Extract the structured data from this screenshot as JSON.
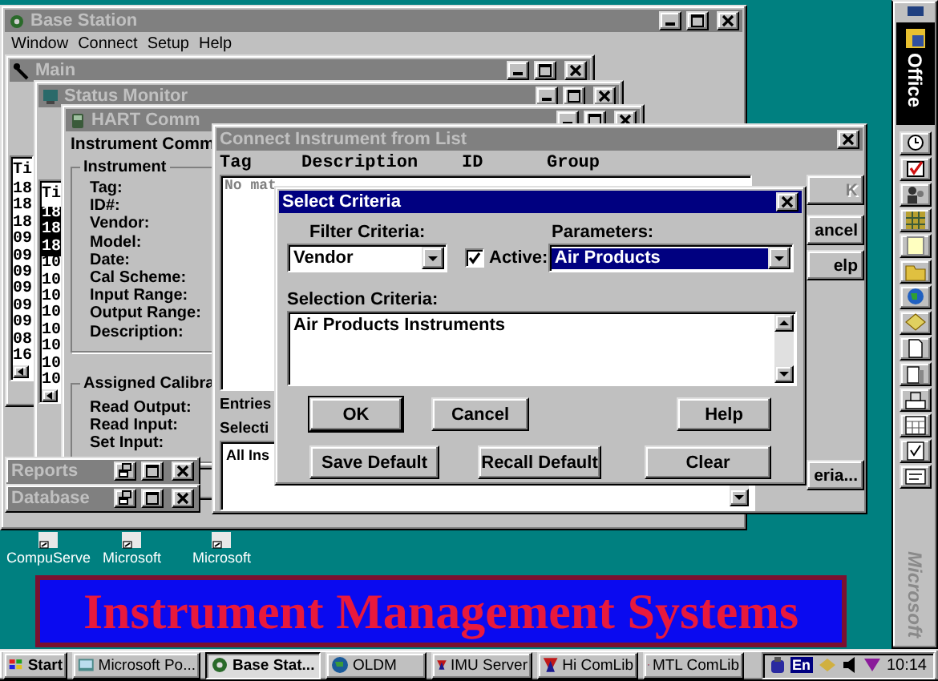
{
  "base_station": {
    "title": "Base Station",
    "active": false,
    "menu": [
      "Window",
      "Connect",
      "Setup",
      "Help"
    ]
  },
  "main_window": {
    "title": "Main",
    "active": false,
    "list_header": "Ti",
    "rows": [
      {
        "text": "18",
        "selected": false
      },
      {
        "text": "18",
        "selected": false
      },
      {
        "text": "18",
        "selected": false
      },
      {
        "text": "09",
        "selected": false
      },
      {
        "text": "09",
        "selected": false
      },
      {
        "text": "09",
        "selected": false
      },
      {
        "text": "09",
        "selected": false
      },
      {
        "text": "09",
        "selected": false
      },
      {
        "text": "09",
        "selected": false
      },
      {
        "text": "08",
        "selected": false
      },
      {
        "text": "16",
        "selected": false
      }
    ]
  },
  "status_monitor": {
    "title": "Status Monitor",
    "active": false,
    "list_header": "Ti",
    "rows": [
      {
        "text": "18",
        "selected": true
      },
      {
        "text": "18",
        "selected": true
      },
      {
        "text": "18",
        "selected": true
      },
      {
        "text": "10",
        "selected": false
      },
      {
        "text": "10",
        "selected": false
      },
      {
        "text": "10",
        "selected": false
      },
      {
        "text": "10",
        "selected": false
      },
      {
        "text": "10",
        "selected": false
      },
      {
        "text": "10",
        "selected": false
      },
      {
        "text": "10",
        "selected": false
      },
      {
        "text": "10",
        "selected": false
      }
    ]
  },
  "hart_comm": {
    "title": "HART Comm",
    "active": false,
    "heading": "Instrument Comm",
    "instrument_group": {
      "label": "Instrument",
      "fields": [
        "Tag:",
        "ID#:",
        "Vendor:",
        "Model:",
        "Date:",
        "Cal Scheme:",
        "Input Range:",
        "Output Range:",
        "Description:"
      ]
    },
    "calibration_group": {
      "label": "Assigned Calibra",
      "fields": [
        "Read Output:",
        "Read Input:",
        "Set Input:"
      ]
    }
  },
  "minimized_windows": [
    {
      "title": "Reports",
      "active": false
    },
    {
      "title": "Database",
      "active": false
    }
  ],
  "connect_dialog": {
    "title": "Connect Instrument from List",
    "active": false,
    "columns": [
      "Tag",
      "Description",
      "ID",
      "Group"
    ],
    "list_text": "No mat",
    "entries_label": "Entries",
    "selection_label": "Selecti",
    "selection_list_text": "All Ins",
    "buttons": [
      {
        "label": "K",
        "disabled": true
      },
      {
        "label": "ancel",
        "disabled": false
      },
      {
        "label": "elp",
        "disabled": false
      },
      {
        "label": "eria...",
        "disabled": false
      }
    ]
  },
  "select_criteria": {
    "title": "Select Criteria",
    "active": true,
    "filter_label": "Filter Criteria:",
    "filter_field": {
      "value": "Vendor",
      "highlighted": false
    },
    "active_filter": {
      "label": "Active:",
      "checked": true
    },
    "parameters_label": "Parameters:",
    "parameters_field": {
      "value": "Air Products",
      "highlighted": true
    },
    "selection_label": "Selection Criteria:",
    "selection_text": "Air Products Instruments",
    "buttons": [
      {
        "label": "OK",
        "default": true
      },
      {
        "label": "Cancel",
        "default": false
      },
      {
        "label": "Help",
        "default": false
      },
      {
        "label": "Save Default",
        "default": false
      },
      {
        "label": "Recall Default",
        "default": false
      },
      {
        "label": "Clear",
        "default": false
      }
    ]
  },
  "desktop_icons": [
    {
      "label": "CompuServe"
    },
    {
      "label": "Microsoft"
    },
    {
      "label": "Microsoft"
    }
  ],
  "banner": {
    "text": "Instrument Management Systems"
  },
  "taskbar": {
    "start": "Start",
    "tasks": [
      {
        "label": "Microsoft Po...",
        "selected": false
      },
      {
        "label": "Base Stat...",
        "selected": true
      },
      {
        "label": "OLDM",
        "selected": false
      },
      {
        "label": "IMU Server",
        "selected": false
      },
      {
        "label": "Hi ComLib",
        "selected": false
      },
      {
        "label": "MTL ComLib",
        "selected": false
      }
    ],
    "tray_language": "En",
    "clock": "10:14"
  },
  "office_bar": {
    "title": "Office",
    "footer": "Microsoft"
  }
}
